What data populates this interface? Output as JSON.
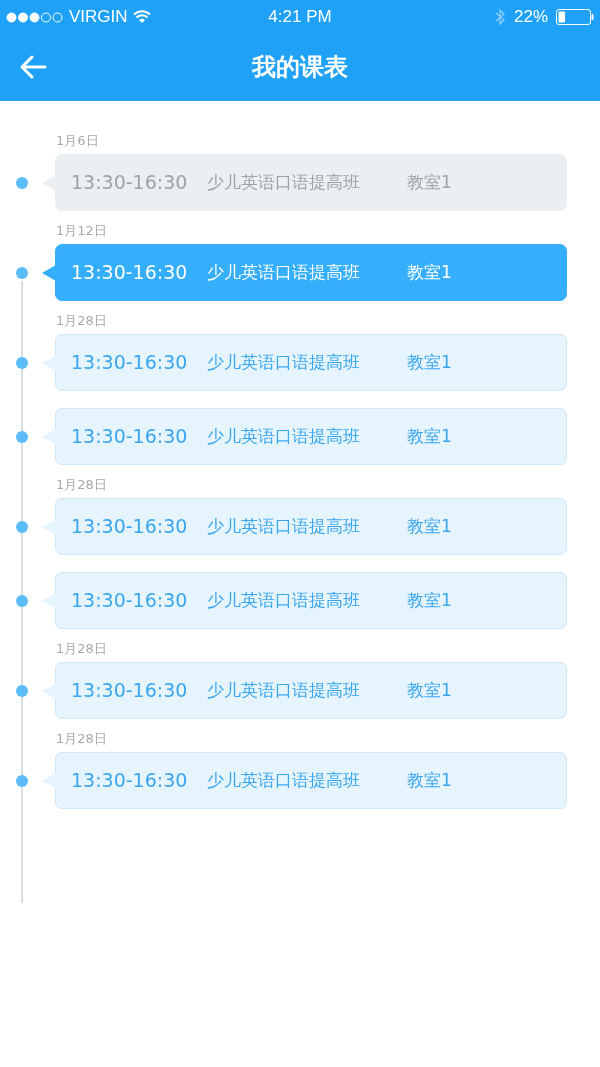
{
  "status_bar": {
    "carrier": "VIRGIN",
    "time": "4:21 PM",
    "battery": "22%"
  },
  "header": {
    "title": "我的课表"
  },
  "lessons": [
    {
      "date": "1月6日",
      "time": "13:30-16:30",
      "course": "少儿英语口语提高班",
      "room": "教室1",
      "kind": "past",
      "selected": false
    },
    {
      "date": "1月12日",
      "time": "13:30-16:30",
      "course": "少儿英语口语提高班",
      "room": "教室1",
      "kind": "upcoming",
      "selected": true
    },
    {
      "date": "1月28日",
      "time": "13:30-16:30",
      "course": "少儿英语口语提高班",
      "room": "教室1",
      "kind": "upcoming",
      "selected": false
    },
    {
      "time": "13:30-16:30",
      "course": "少儿英语口语提高班",
      "room": "教室1",
      "kind": "upcoming",
      "selected": false
    },
    {
      "date": "1月28日",
      "time": "13:30-16:30",
      "course": "少儿英语口语提高班",
      "room": "教室1",
      "kind": "upcoming",
      "selected": false
    },
    {
      "time": "13:30-16:30",
      "course": "少儿英语口语提高班",
      "room": "教室1",
      "kind": "upcoming",
      "selected": false
    },
    {
      "date": "1月28日",
      "time": "13:30-16:30",
      "course": "少儿英语口语提高班",
      "room": "教室1",
      "kind": "upcoming",
      "selected": false
    },
    {
      "date": "1月28日",
      "time": "13:30-16:30",
      "course": "少儿英语口语提高班",
      "room": "教室1",
      "kind": "upcoming",
      "selected": false
    }
  ]
}
